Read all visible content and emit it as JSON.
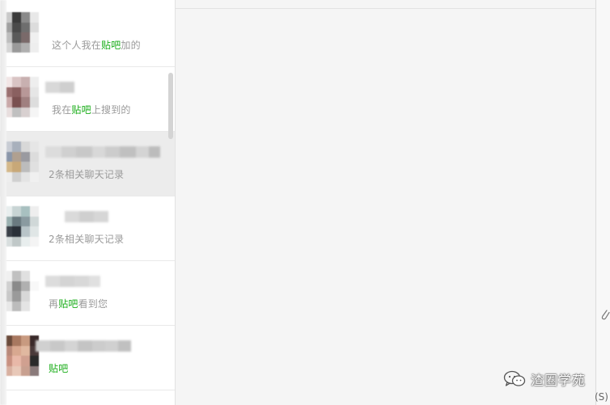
{
  "results": [
    {
      "snippet_parts": [
        {
          "text": "这个人我在",
          "kw": false
        },
        {
          "text": "贴吧",
          "kw": true
        },
        {
          "text": "加的",
          "kw": false
        }
      ],
      "selected": false
    },
    {
      "snippet_parts": [
        {
          "text": "我在",
          "kw": false
        },
        {
          "text": "贴吧",
          "kw": true
        },
        {
          "text": "上搜到的",
          "kw": false
        }
      ],
      "selected": false
    },
    {
      "snippet_parts": [
        {
          "text": "2条相关聊天记录",
          "kw": false
        }
      ],
      "selected": true
    },
    {
      "snippet_parts": [
        {
          "text": "2条相关聊天记录",
          "kw": false
        }
      ],
      "selected": false
    },
    {
      "snippet_parts": [
        {
          "text": "再",
          "kw": false
        },
        {
          "text": "贴吧",
          "kw": true
        },
        {
          "text": "看到您",
          "kw": false
        }
      ],
      "selected": false
    },
    {
      "snippet_parts": [
        {
          "text": "贴吧",
          "kw": true
        }
      ],
      "selected": false
    }
  ],
  "chat": {
    "shortcut_hint": "(S)"
  },
  "watermark": {
    "text": "渣圈学苑"
  },
  "colors": {
    "keyword": "#1aad19",
    "snippet": "#9a9a9a",
    "selected_bg": "#ececec",
    "panel_bg": "#ffffff",
    "chat_bg": "#f5f5f5"
  },
  "icons": {
    "attach": "paperclip-icon",
    "watermark_logo": "wechat-logo-icon"
  }
}
